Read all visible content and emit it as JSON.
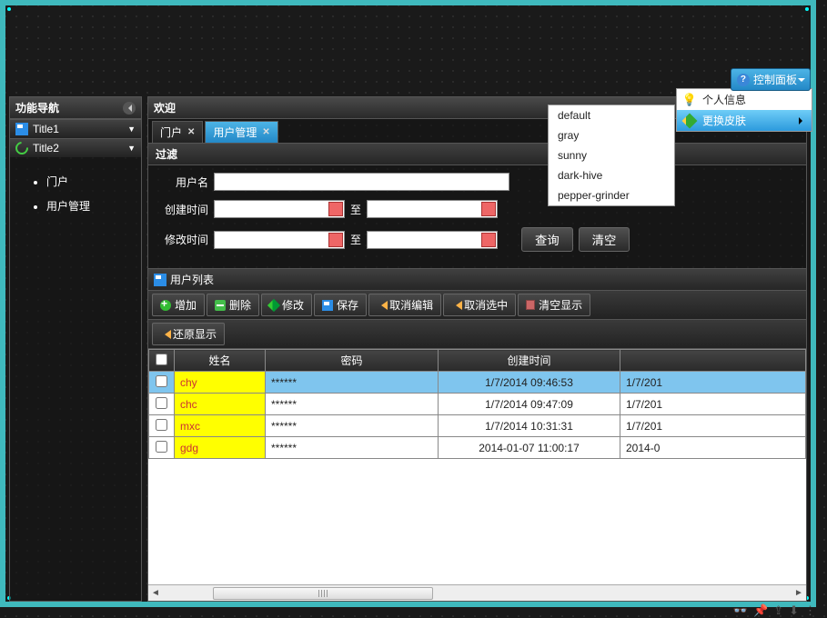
{
  "sidebar": {
    "title": "功能导航",
    "sections": [
      {
        "label": "Title1",
        "icon": "disk"
      },
      {
        "label": "Title2",
        "icon": "refresh"
      }
    ],
    "tree": [
      {
        "label": "门户"
      },
      {
        "label": "用户管理"
      }
    ]
  },
  "main": {
    "title": "欢迎",
    "tabs": [
      {
        "label": "门户",
        "active": false
      },
      {
        "label": "用户管理",
        "active": true
      }
    ],
    "filter": {
      "title": "过滤",
      "username_label": "用户名",
      "created_label": "创建时间",
      "modified_label": "修改时间",
      "to_label": "至",
      "btn_search": "查询",
      "btn_clear": "清空"
    },
    "list": {
      "title": "用户列表",
      "toolbar": {
        "add": "增加",
        "del": "删除",
        "edit": "修改",
        "save": "保存",
        "cancel_edit": "取消编辑",
        "cancel_sel": "取消选中",
        "clear_disp": "清空显示",
        "restore": "还原显示"
      },
      "columns": {
        "name": "姓名",
        "pwd": "密码",
        "created": "创建时间",
        "modified": ""
      },
      "rows": [
        {
          "name": "chy",
          "pwd": "******",
          "created": "1/7/2014 09:46:53",
          "modified": "1/7/201",
          "selected": true
        },
        {
          "name": "chc",
          "pwd": "******",
          "created": "1/7/2014 09:47:09",
          "modified": "1/7/201",
          "selected": false
        },
        {
          "name": "mxc",
          "pwd": "******",
          "created": "1/7/2014 10:31:31",
          "modified": "1/7/201",
          "selected": false
        },
        {
          "name": "gdg",
          "pwd": "******",
          "created": "2014-01-07 11:00:17",
          "modified": "2014-0",
          "selected": false
        }
      ]
    }
  },
  "control_panel": {
    "button": "控制面板",
    "menu": [
      {
        "label": "个人信息",
        "icon": "bulb"
      },
      {
        "label": "更换皮肤",
        "icon": "pencil",
        "hl": true
      }
    ],
    "skins": [
      "default",
      "gray",
      "sunny",
      "dark-hive",
      "pepper-grinder"
    ]
  }
}
